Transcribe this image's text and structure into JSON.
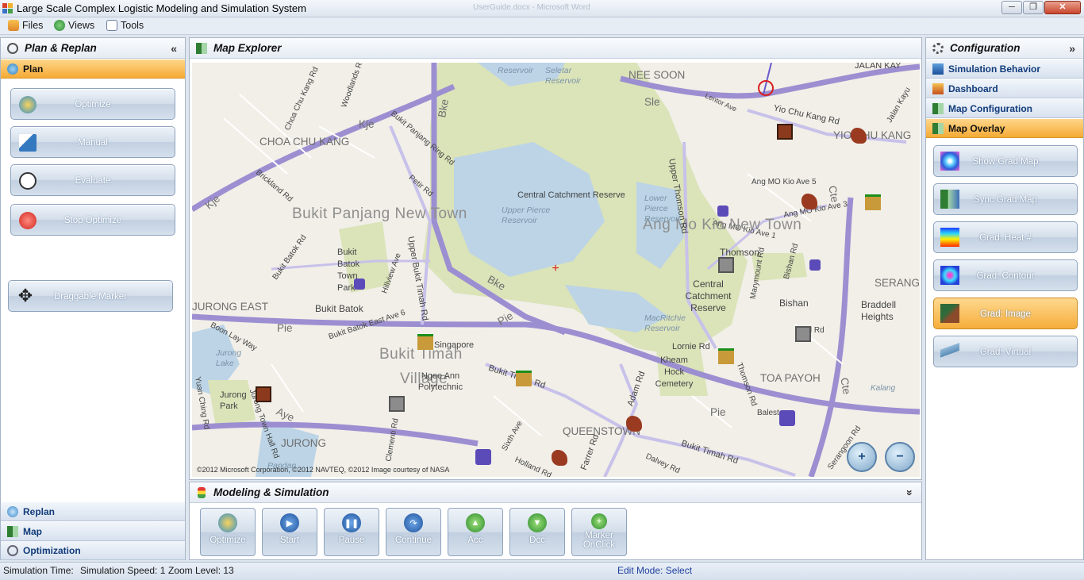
{
  "window": {
    "title": "Large Scale Complex Logistic Modeling and Simulation System",
    "ghost_title": "UserGuide.docx - Microsoft Word",
    "controls": [
      "─",
      "❐",
      "✕"
    ]
  },
  "menu": [
    "Files",
    "Views",
    "Tools"
  ],
  "left_panel": {
    "title": "Plan & Replan",
    "collapse": "«",
    "active_section": "Plan",
    "buttons": [
      "Optimize",
      "Manual",
      "Evaluate",
      "Stop Optimize"
    ],
    "marker_button": "Draggable Marker",
    "bottom_sections": [
      "Replan",
      "Map",
      "Optimization"
    ]
  },
  "map_panel": {
    "title": "Map Explorer",
    "copyright": "©2012 Microsoft Corporation, ©2012 NAVTEQ, ©2012 Image courtesy of NASA",
    "zoom_in": "+",
    "zoom_out": "−",
    "labels": {
      "nee_soon": "NEE SOON",
      "choa": "CHOA CHU KANG",
      "yio": "YIO CHU KANG",
      "bukit_panjang": "Bukit Panjang New Town",
      "amk": "Ang Mo Kio New Town",
      "central_catchment": "Central Catchment Reserve",
      "upper_pierce": "Upper Pierce Reservoir",
      "lower_pierce": "Lower Pierce Reservoir",
      "thomson": "Thomson",
      "central_catchment2": "Central Catchment Reserve",
      "bishan": "Bishan",
      "braddell": "Braddell Heights",
      "serang": "SERANG",
      "jurong_east": "JURONG EAST",
      "bukit_batok": "Bukit Batok",
      "bukit_batok_town": "Bukit Batok Town Park",
      "bukit_timah": "Bukit Timah",
      "village": "Village",
      "ngee_ann": "Ngee Ann Polytechnic",
      "singapore": "Singapore",
      "macritchie": "MacRitchie Reservoir",
      "lornie": "Lornie Rd",
      "kheam_hock": "Kheam Hock Cemetery",
      "toa_payoh": "TOA PAYOH",
      "jurong_lake": "Jurong Lake",
      "jurong_park": "Jurong Park",
      "jurong": "JURONG",
      "queenstown": "QUEENSTOWN",
      "kalang": "Kalang",
      "balestier": "Balest",
      "jalan_kayu": "JALAN KAY",
      "seletar": "Seletar Reservoir",
      "reservoir_top": "Reservoir",
      "yio_chu_kang_rd": "Yio Chu Kang Rd",
      "lentor": "Lentor Ave",
      "ang_mo_kio_ave5": "Ang MO Kio Ave 5",
      "ang_mo_kio_ave3": "Ang MO Kio Ave 3",
      "ang_mo_kio_ave1": "Ang MO Kio Ave 1",
      "upper_thomson": "Upper Thomson Rd",
      "upper_bukit_timah": "Upper Bukit Timah Rd",
      "bukit_timah_rd": "Bukit Timah Rd",
      "bukit_timah_rd2": "Bukit Timah Rd",
      "pie": "Pie",
      "pie2": "Pie",
      "pie3": "Pie",
      "bke": "Bke",
      "bke2": "Bke",
      "kje": "Kje",
      "kje2": "Kje",
      "sle": "Sle",
      "cte": "Cte",
      "cte2": "Cte",
      "ayer": "Aye",
      "adam": "Adam Rd",
      "farrer": "Farrer Rd",
      "dunearn": "Bishan Rd",
      "marymount": "Marymount Rd",
      "jurong_town_hall": "Jurong Town Hall Rd",
      "boon_lay": "Boon Lay Way",
      "bukit_batok_rd": "Bukit Batok Rd",
      "bukit_batok_ave6": "Bukit Batok East Ave 6",
      "hillview": "Hillview Ave",
      "brickland": "Brickland Rd",
      "petir": "Petir Rd",
      "woodlands": "Woodlands Rd",
      "choa_chu_kang_rd": "Choa Chu Kang Rd",
      "bukit_panjang_rd": "Bukit Panjang Ring Rd",
      "serangoon": "Serangoon Rd",
      "sixth_ave": "Sixth Ave",
      "clementi": "Clementi Rd",
      "holland": "Holland Rd",
      "dalvey": "Dalvey Rd",
      "thomson_rd": "Thomson Rd",
      "jalan_kayu_rd": "Jalan Kayu",
      "yuan_ching": "Yuan Ching Rd",
      "pandan": "Pandan",
      "brad": "Brad Rd"
    }
  },
  "modeling_panel": {
    "title": "Modeling & Simulation",
    "collapse": "»",
    "buttons": [
      "Optimize",
      "Start",
      "Pause",
      "Continue",
      "Acc",
      "Dcc",
      "Marker OnClick"
    ]
  },
  "config_panel": {
    "title": "Configuration",
    "collapse": "»",
    "sections": [
      "Simulation Behavior",
      "Dashboard",
      "Map Configuration",
      "Map Overlay"
    ],
    "active_section": "Map Overlay",
    "buttons": [
      "Show Grad Map",
      "Sync Grad Map",
      "Grad: Heat #",
      "Grad: Contour",
      "Grad: Image",
      "Grad: Virtual"
    ],
    "active_button": "Grad: Image"
  },
  "status": {
    "simulation_time": "Simulation Time:",
    "simulation_speed": "Simulation Speed: 1",
    "zoom_level": "Zoom Level: 13",
    "edit_mode": "Edit Mode: Select"
  },
  "colors": {
    "accent_orange": "#f6ad3a",
    "header_blue": "#113b7a",
    "map_green": "#d9e2b6",
    "water": "#b9d3e6"
  }
}
